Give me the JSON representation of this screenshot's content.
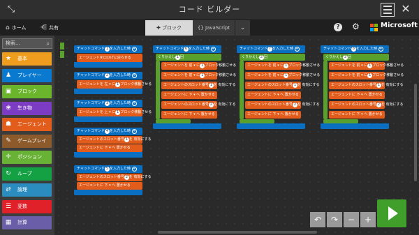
{
  "title": "コード ビルダー",
  "toolbar": {
    "home_label": "ホーム",
    "share_label": "共有",
    "tab_blocks": "ブロック",
    "tab_js": "JavaScript",
    "microsoft": "Microsoft"
  },
  "sidebar": {
    "search_placeholder": "検索...",
    "categories": [
      {
        "label": "基本",
        "color": "#ef9d1e",
        "icon": "star-icon",
        "glyph": "★"
      },
      {
        "label": "プレイヤー",
        "color": "#0a7ad0",
        "icon": "person-icon",
        "glyph": "♟"
      },
      {
        "label": "ブロック",
        "color": "#6bb52c",
        "icon": "cube-icon",
        "glyph": "▣"
      },
      {
        "label": "生き物",
        "color": "#7c3dc4",
        "icon": "paw-icon",
        "glyph": "❀"
      },
      {
        "label": "エージェント",
        "color": "#e25c1b",
        "icon": "agent-icon",
        "glyph": "☗"
      },
      {
        "label": "ゲームプレイ",
        "color": "#8d5a2b",
        "icon": "wrench-icon",
        "glyph": "✎"
      },
      {
        "label": "ポジション",
        "color": "#68b236",
        "icon": "target-icon",
        "glyph": "✛"
      },
      {
        "label": "ループ",
        "color": "#14a144",
        "icon": "loop-icon",
        "glyph": "↻"
      },
      {
        "label": "論理",
        "color": "#2b8dbf",
        "icon": "shuffle-icon",
        "glyph": "⇄"
      },
      {
        "label": "変数",
        "color": "#e0212a",
        "icon": "list-icon",
        "glyph": "☰"
      },
      {
        "label": "計算",
        "color": "#6b5ea8",
        "icon": "calculator-icon",
        "glyph": "▦"
      }
    ]
  },
  "blocks": {
    "hat_prefix": "チャットコマンド",
    "hat_suffix": "を入力した時",
    "repeat_label": "くりかえし",
    "repeat_suffix": "回",
    "agent_say": "エージェントを口ひげに戻らせる",
    "move_fwd": "エージェントを 前 ▾ に",
    "move_up": "エージェントを 上 ▾ に",
    "move_left": "エージェントを 左 ▾ に",
    "place": "ブロック移動させる",
    "slot": "エージェントのスロット番号",
    "slot_suffix": "を 有効にする",
    "turn": "エージェントに 下 ▾ へ 置かせる",
    "cmd_values": [
      "1",
      "2",
      "3",
      "4",
      "5",
      "6",
      "7",
      "8"
    ]
  },
  "colors": {
    "hat": "#0b6fc1",
    "agent": "#e25c1b",
    "loop": "#5aa02c",
    "run": "#3f9f2a"
  }
}
